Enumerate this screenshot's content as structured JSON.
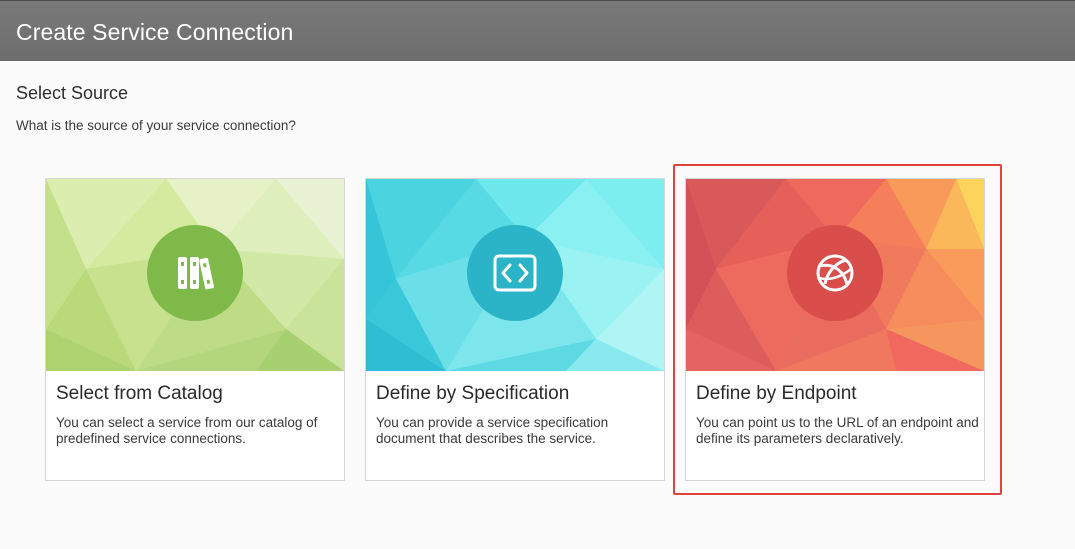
{
  "header": {
    "title": "Create Service Connection"
  },
  "section": {
    "title": "Select Source",
    "description": "What is the source of your service connection?"
  },
  "cards": [
    {
      "title": "Select from Catalog",
      "description": "You can select a service from our catalog of predefined service connections.",
      "icon": "books-icon",
      "color": "#7fb94a"
    },
    {
      "title": "Define by Specification",
      "description": "You can provide a service specification document that describes the service.",
      "icon": "code-icon",
      "color": "#2bb3c8"
    },
    {
      "title": "Define by Endpoint",
      "description": "You can point us to the URL of an endpoint and define its parameters declaratively.",
      "icon": "endpoint-globe-icon",
      "color": "#e5504b",
      "selected": true
    }
  ],
  "colors": {
    "selection_outline": "#e0413b",
    "header_bg": "#737373"
  }
}
